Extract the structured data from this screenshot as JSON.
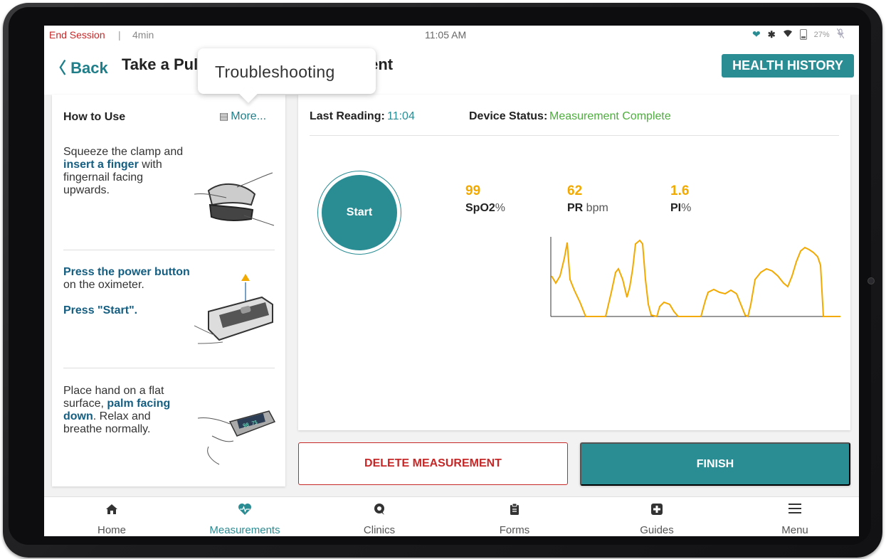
{
  "status_bar": {
    "end_session": "End Session",
    "separator": "|",
    "duration": "4min",
    "time": "11:05 AM",
    "battery": "27%",
    "icons": [
      "heart-monitor-icon",
      "bluetooth-icon",
      "wifi-icon",
      "battery-icon",
      "mic-muted-icon"
    ]
  },
  "header": {
    "back": "〈 Back",
    "title": "Take a Pulse Oximeter Measurement",
    "health_history": "HEALTH HISTORY"
  },
  "tooltip": {
    "text": "Troubleshooting"
  },
  "how_to_use": {
    "title": "How to Use",
    "more": "More...",
    "steps": [
      {
        "pre": "Squeeze the clamp and ",
        "bold": "insert a finger",
        "post": " with fingernail facing upwards."
      },
      {
        "bold": "Press the power button",
        "post": " on the oximeter.",
        "bold2": "Press \"Start\"."
      },
      {
        "pre": "Place hand on a flat surface, ",
        "bold": "palm facing down",
        "post": ". Relax and breathe normally."
      }
    ],
    "device_display": "98 75"
  },
  "reading": {
    "last_reading_label": "Last Reading:",
    "last_reading_value": "11:04",
    "device_status_label": "Device Status:",
    "device_status_value": "Measurement Complete",
    "start": "Start",
    "metrics": [
      {
        "value": "99",
        "label_bold": "SpO2",
        "label_unit": "%"
      },
      {
        "value": "62",
        "label_bold": "PR",
        "label_unit": " bpm"
      },
      {
        "value": "1.6",
        "label_bold": "PI",
        "label_unit": "%"
      }
    ],
    "waveform_color": "#f2a900"
  },
  "actions": {
    "delete": "DELETE MEASUREMENT",
    "finish": "FINISH"
  },
  "bottom_nav": [
    {
      "label": "Home",
      "icon": "home-icon",
      "active": false
    },
    {
      "label": "Measurements",
      "icon": "heart-pulse-icon",
      "active": true
    },
    {
      "label": "Clinics",
      "icon": "chat-bubble-icon",
      "active": false
    },
    {
      "label": "Forms",
      "icon": "clipboard-icon",
      "active": false
    },
    {
      "label": "Guides",
      "icon": "plus-square-icon",
      "active": false
    },
    {
      "label": "Menu",
      "icon": "hamburger-menu-icon",
      "active": false
    }
  ],
  "colors": {
    "accent": "#2a8d94",
    "danger": "#c62828",
    "reading_value": "#f2a900",
    "status_ok": "#4caf3c",
    "instruction_bold": "#145e82"
  }
}
